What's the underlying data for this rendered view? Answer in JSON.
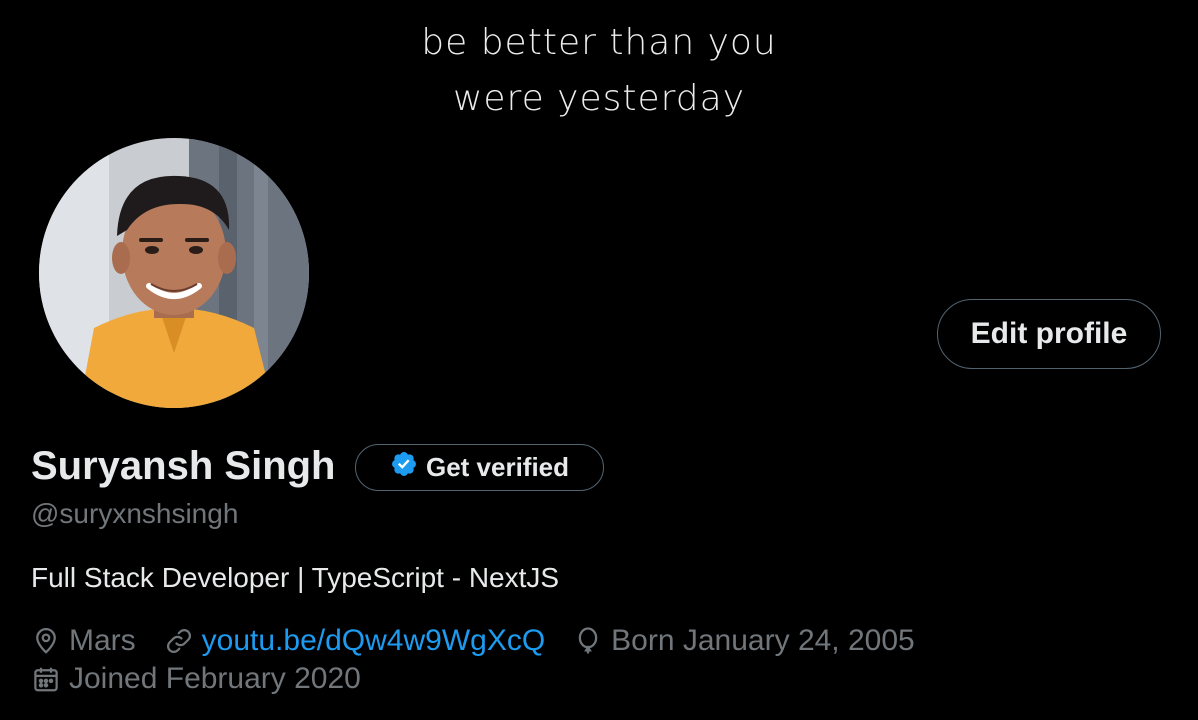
{
  "banner": {
    "line1": "be better than you",
    "line2": "were yesterday"
  },
  "profile": {
    "name": "Suryansh Singh",
    "handle": "@suryxnshsingh",
    "bio": "Full Stack Developer | TypeScript - NextJS",
    "location": "Mars",
    "website": "youtu.be/dQw4w9WgXcQ",
    "birthday": "Born January 24, 2005",
    "joined": "Joined February 2020"
  },
  "actions": {
    "edit_profile": "Edit profile",
    "get_verified": "Get verified"
  },
  "colors": {
    "background": "#000000",
    "text_primary": "#e7e9ea",
    "text_secondary": "#71767b",
    "link": "#1d9bf0",
    "verified_badge": "#1d9bf0",
    "button_border": "#536471"
  },
  "icons": {
    "verified": "verified-badge-icon",
    "location": "location-pin-icon",
    "website": "link-icon",
    "birthday": "balloon-icon",
    "joined": "calendar-icon"
  }
}
